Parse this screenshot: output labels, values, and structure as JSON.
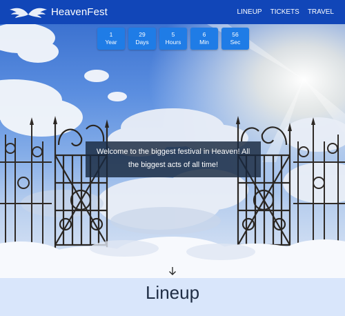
{
  "brand": {
    "name": "HeavenFest",
    "logo_icon": "wings-icon"
  },
  "nav": {
    "links": [
      "LINEUP",
      "TICKETS",
      "TRAVEL"
    ]
  },
  "countdown": [
    {
      "value": "1",
      "unit": "Year"
    },
    {
      "value": "29",
      "unit": "Days"
    },
    {
      "value": "5",
      "unit": "Hours"
    },
    {
      "value": "6",
      "unit": "Min"
    },
    {
      "value": "56",
      "unit": "Sec"
    }
  ],
  "hero": {
    "welcome_line1": "Welcome to the biggest festival in Heaven! All",
    "welcome_line2": "the biggest acts of all time!",
    "scroll_icon": "arrow-down-icon"
  },
  "lineup": {
    "title": "Lineup"
  },
  "colors": {
    "navbar": "#1146b8",
    "countdown_box": "#1f7ce6",
    "lineup_bg": "#d9e6fb"
  }
}
